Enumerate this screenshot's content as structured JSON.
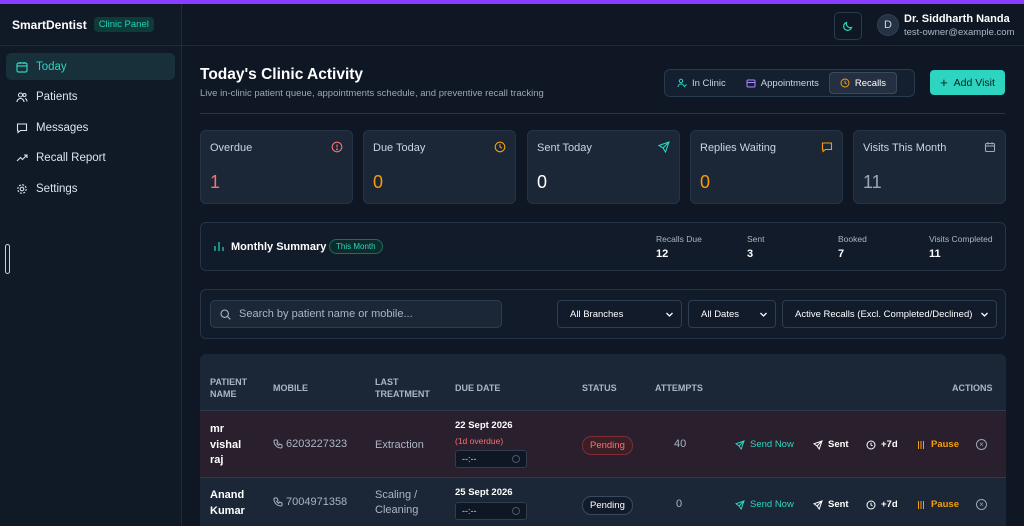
{
  "app": {
    "name": "SmartDentist",
    "panel_badge": "Clinic Panel"
  },
  "sidebar": {
    "items": [
      {
        "label": "Today",
        "icon": "calendar-icon",
        "active": true
      },
      {
        "label": "Patients",
        "icon": "users-icon",
        "active": false
      },
      {
        "label": "Messages",
        "icon": "message-icon",
        "active": false
      },
      {
        "label": "Recall Report",
        "icon": "trend-icon",
        "active": false
      },
      {
        "label": "Settings",
        "icon": "gear-icon",
        "active": false
      }
    ]
  },
  "header": {
    "avatar_initial": "D",
    "user_name": "Dr. Siddharth Nanda",
    "user_email": "test-owner@example.com"
  },
  "page": {
    "title": "Today's Clinic Activity",
    "subtitle": "Live in-clinic patient queue, appointments schedule, and preventive recall tracking",
    "tabs": [
      {
        "label": "In Clinic",
        "active": false
      },
      {
        "label": "Appointments",
        "active": false
      },
      {
        "label": "Recalls",
        "active": true
      }
    ],
    "add_visit": "Add Visit"
  },
  "stats": [
    {
      "label": "Overdue",
      "value": "1",
      "color": "#f87171"
    },
    {
      "label": "Due Today",
      "value": "0",
      "color": "#f59e0b"
    },
    {
      "label": "Sent Today",
      "value": "0",
      "color": "#ffffff"
    },
    {
      "label": "Replies Waiting",
      "value": "0",
      "color": "#f59e0b"
    },
    {
      "label": "Visits This Month",
      "value": "11",
      "color": "#9aa7b6"
    }
  ],
  "summary": {
    "title": "Monthly Summary",
    "badge": "This Month",
    "items": [
      {
        "label": "Recalls Due",
        "value": "12"
      },
      {
        "label": "Sent",
        "value": "3"
      },
      {
        "label": "Booked",
        "value": "7"
      },
      {
        "label": "Visits Completed",
        "value": "11"
      }
    ]
  },
  "filters": {
    "search_placeholder": "Search by patient name or mobile...",
    "branch": "All Branches",
    "dates": "All Dates",
    "recall_filter": "Active Recalls (Excl. Completed/Declined)"
  },
  "table": {
    "headers": {
      "patient_line1": "PATIENT",
      "patient_line2": "NAME",
      "mobile": "MOBILE",
      "treatment_line1": "LAST",
      "treatment_line2": "TREATMENT",
      "due_date": "DUE DATE",
      "status": "STATUS",
      "attempts": "ATTEMPTS",
      "actions": "ACTIONS"
    },
    "rows": [
      {
        "name_lines": [
          "mr",
          "vishal",
          "raj"
        ],
        "mobile": "6203227323",
        "treatment_lines": [
          "Extraction"
        ],
        "due_date": "22 Sept 2026",
        "overdue_note": "(1d overdue)",
        "time_placeholder": "--:--",
        "status": "Pending",
        "attempts": "40"
      },
      {
        "name_lines": [
          "Anand",
          "Kumar"
        ],
        "mobile": "7004971358",
        "treatment_lines": [
          "Scaling /",
          "Cleaning"
        ],
        "due_date": "25 Sept 2026",
        "overdue_note": "",
        "time_placeholder": "--:--",
        "status": "Pending",
        "attempts": "0"
      }
    ],
    "actions": {
      "send_now": "Send Now",
      "sent": "Sent",
      "plus7": "+7d",
      "pause": "Pause"
    }
  }
}
